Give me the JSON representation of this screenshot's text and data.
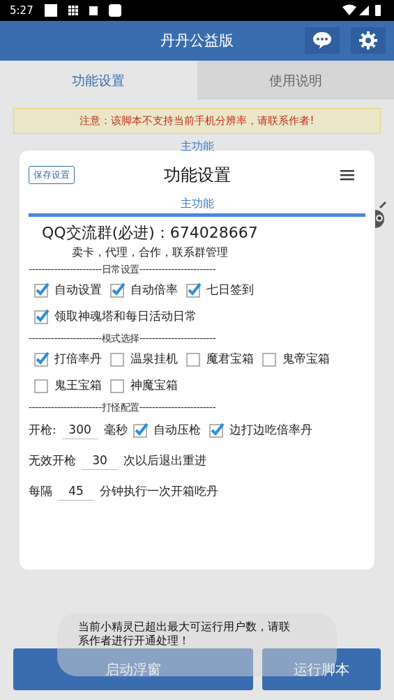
{
  "status_bar": {
    "time": "5:27"
  },
  "app_bar": {
    "title": "丹丹公益版"
  },
  "tabs": [
    {
      "label": "功能设置",
      "selected": true
    },
    {
      "label": "使用说明",
      "selected": false
    }
  ],
  "warning": "注意：该脚本不支持当前手机分辨率，请联系作者!",
  "section_label": "主功能",
  "dialog": {
    "save_button": "保存设置",
    "title": "功能设置",
    "tab": "主功能",
    "group_line": "QQ交流群(必进)：674028667",
    "group_subtitle": "卖卡，代理，合作，联系群管理",
    "sections": [
      {
        "divider": "-----------------------日常设置------------------------",
        "rows": [
          [
            {
              "kind": "checkbox",
              "label": "自动设置",
              "checked": true
            },
            {
              "kind": "checkbox",
              "label": "自动倍率",
              "checked": true
            },
            {
              "kind": "checkbox",
              "label": "七日签到",
              "checked": true
            }
          ],
          [
            {
              "kind": "checkbox",
              "label": "领取神魂塔和每日活动日常",
              "checked": true
            }
          ]
        ]
      },
      {
        "divider": "-----------------------模式选择------------------------",
        "rows": [
          [
            {
              "kind": "checkbox",
              "label": "打倍率丹",
              "checked": true
            },
            {
              "kind": "checkbox",
              "label": "温泉挂机",
              "checked": false
            },
            {
              "kind": "checkbox",
              "label": "魔君宝箱",
              "checked": false
            },
            {
              "kind": "checkbox",
              "label": "鬼帝宝箱",
              "checked": false
            }
          ],
          [
            {
              "kind": "checkbox",
              "label": "鬼王宝箱",
              "checked": false
            },
            {
              "kind": "checkbox",
              "label": "神魔宝箱",
              "checked": false
            }
          ]
        ]
      },
      {
        "divider": "-----------------------打怪配置------------------------",
        "rows": [
          [
            {
              "kind": "text",
              "label": "开枪:"
            },
            {
              "kind": "input",
              "value": "300"
            },
            {
              "kind": "text",
              "label": "毫秒"
            },
            {
              "kind": "checkbox",
              "label": "自动压枪",
              "checked": true
            },
            {
              "kind": "checkbox",
              "label": "边打边吃倍率丹",
              "checked": true
            }
          ],
          [
            {
              "kind": "text",
              "label": "无效开枪"
            },
            {
              "kind": "input",
              "value": "30"
            },
            {
              "kind": "text",
              "label": "次以后退出重进"
            }
          ],
          [
            {
              "kind": "text",
              "label": "每隔"
            },
            {
              "kind": "input",
              "value": "45"
            },
            {
              "kind": "text",
              "label": "分钟执行一次开箱吃丹"
            }
          ]
        ]
      }
    ]
  },
  "buttons": [
    "启动浮窗",
    "运行脚本"
  ],
  "toast": "当前小精灵已超出最大可运行用户数，请联系作者进行开通处理！"
}
